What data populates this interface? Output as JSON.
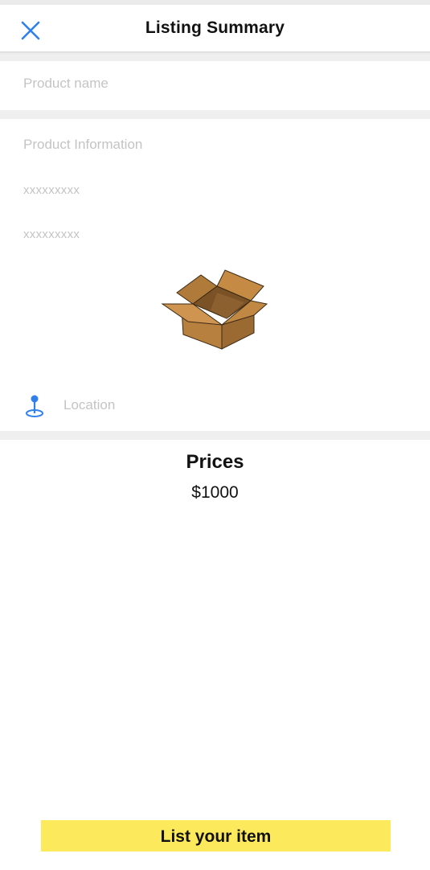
{
  "header": {
    "title": "Listing Summary",
    "close_icon": "close-icon",
    "accent_color": "#2f80ed"
  },
  "product_name": {
    "placeholder": "Product name",
    "value": ""
  },
  "product_info": {
    "label": "Product Information",
    "lines": [
      "xxxxxxxxx",
      "xxxxxxxxx"
    ],
    "image_icon": "open-cardboard-box"
  },
  "location": {
    "icon": "location-pin-icon",
    "label": "Location"
  },
  "prices": {
    "title": "Prices",
    "value": "$1000"
  },
  "cta": {
    "label": "List your item",
    "color": "#fde95c"
  }
}
